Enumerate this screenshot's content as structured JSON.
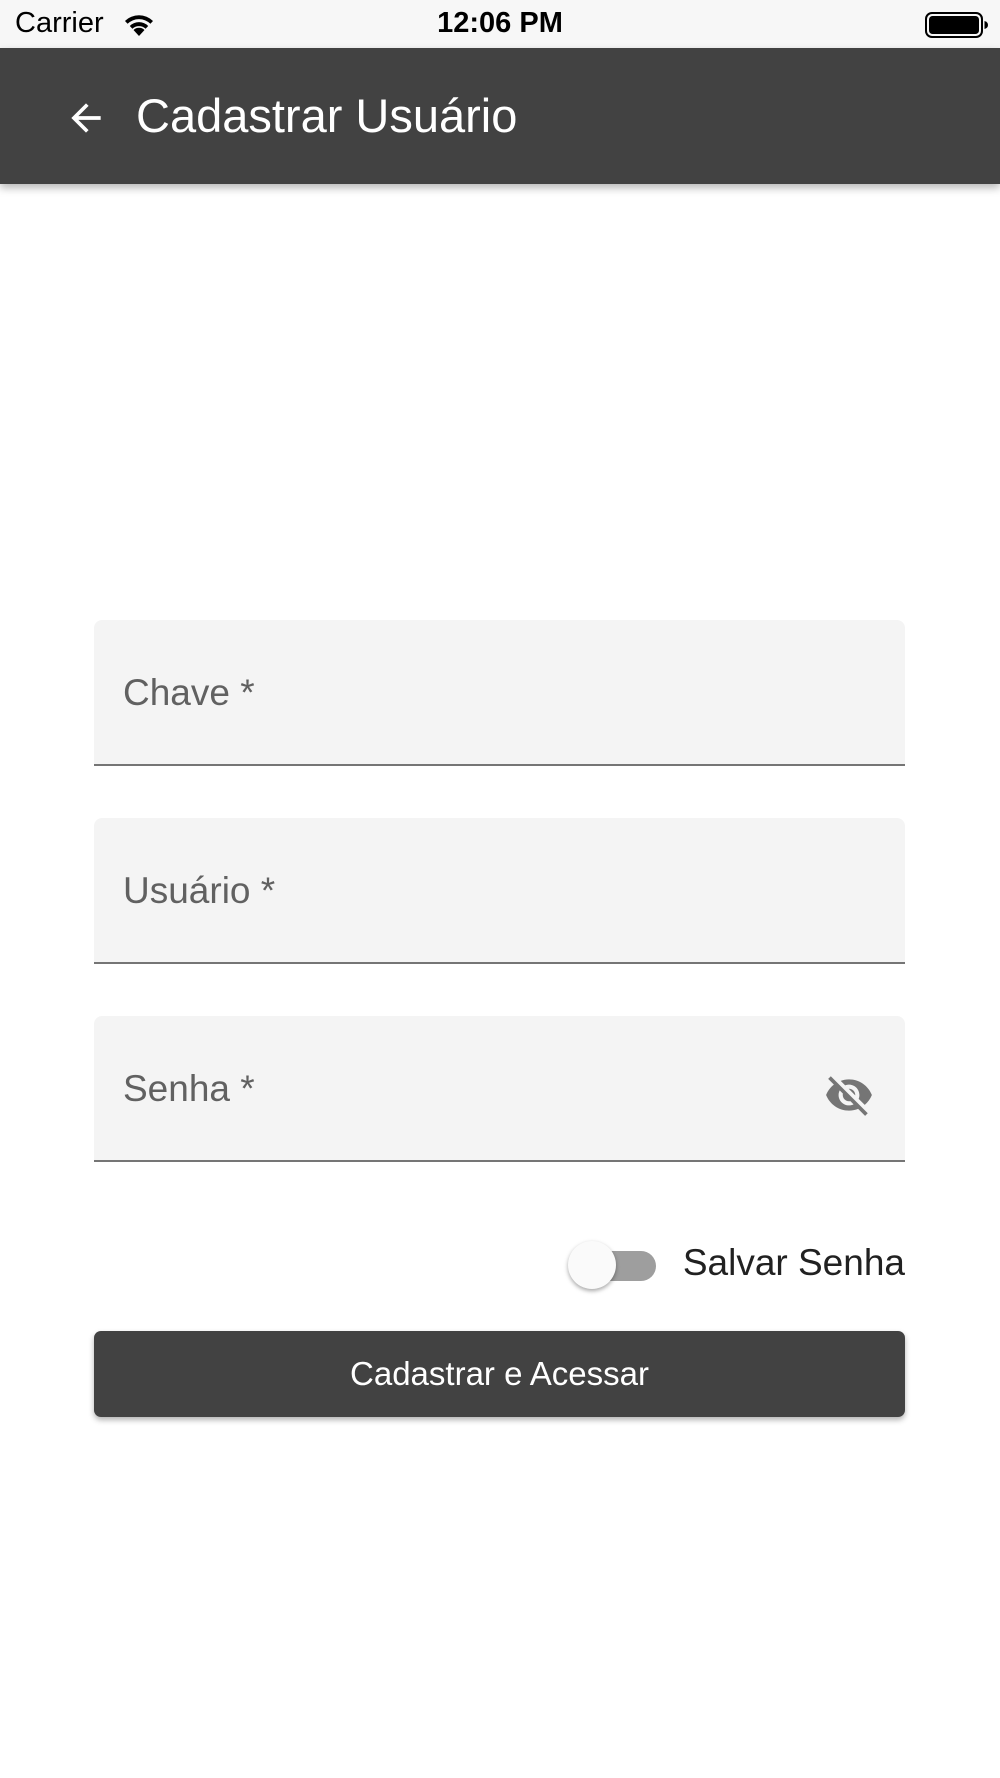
{
  "status_bar": {
    "carrier": "Carrier",
    "time": "12:06 PM",
    "icons": [
      "wifi-icon",
      "battery-icon"
    ]
  },
  "app_bar": {
    "title": "Cadastrar Usuário",
    "back_icon": "arrow-left-icon"
  },
  "form": {
    "chave": {
      "label": "Chave *",
      "value": ""
    },
    "usuario": {
      "label": "Usuário *",
      "value": ""
    },
    "senha": {
      "label": "Senha *",
      "value": "",
      "visibility_icon": "eye-off-icon"
    },
    "save_password": {
      "label": "Salvar Senha",
      "checked": false
    },
    "submit_label": "Cadastrar e Acessar"
  },
  "colors": {
    "app_bar": "#424242",
    "field_background": "#f4f4f4",
    "button": "#424242",
    "switch_track": "#9e9e9e"
  }
}
